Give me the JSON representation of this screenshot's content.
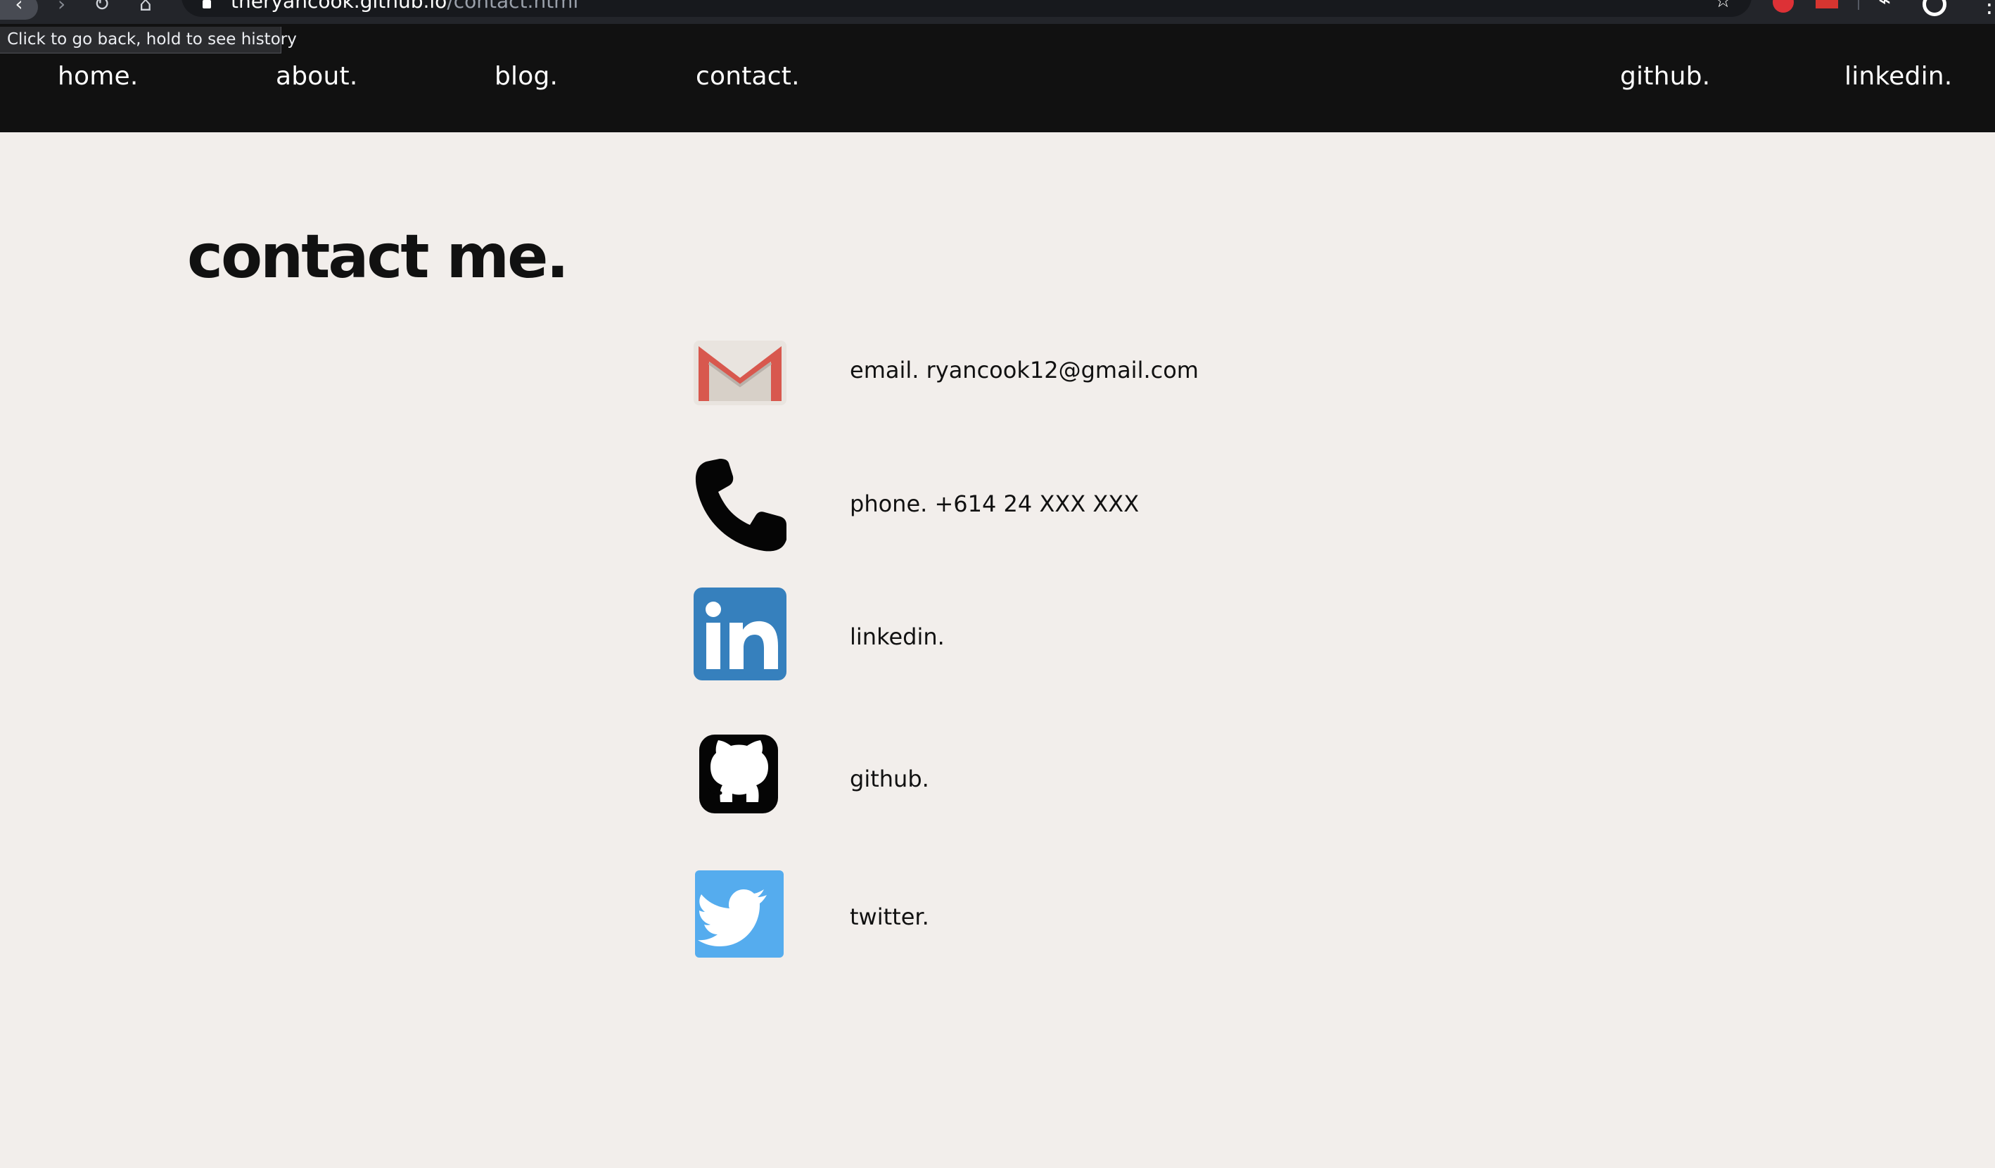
{
  "browser": {
    "url_host": "theryancook.github.io",
    "url_path": "/contact.html",
    "tooltip": "Click to go back, hold to see history",
    "icons": {
      "back": "back-arrow-icon",
      "forward": "forward-arrow-icon",
      "reload": "reload-icon",
      "home": "home-icon",
      "lock": "lock-icon",
      "star": "bookmark-star-icon",
      "profile": "profile-icon",
      "more": "more-options-icon"
    }
  },
  "nav": {
    "left": [
      {
        "label": "home."
      },
      {
        "label": "about."
      },
      {
        "label": "blog."
      },
      {
        "label": "contact."
      }
    ],
    "right": [
      {
        "label": "github."
      },
      {
        "label": "linkedin."
      }
    ]
  },
  "page": {
    "title": "contact me."
  },
  "contacts": [
    {
      "label": "email. ryancook12@gmail.com",
      "icon": "gmail-icon"
    },
    {
      "label": "phone. +614 24 XXX XXX",
      "icon": "phone-icon"
    },
    {
      "label": "linkedin.",
      "icon": "linkedin-icon"
    },
    {
      "label": "github.",
      "icon": "github-icon"
    },
    {
      "label": "twitter.",
      "icon": "twitter-icon"
    }
  ],
  "colors": {
    "nav_background": "#111111",
    "page_background": "#f2eeeb",
    "gmail_red": "#d8584e",
    "linkedin_blue": "#3680bd",
    "twitter_blue": "#55acee",
    "text": "#111111"
  }
}
